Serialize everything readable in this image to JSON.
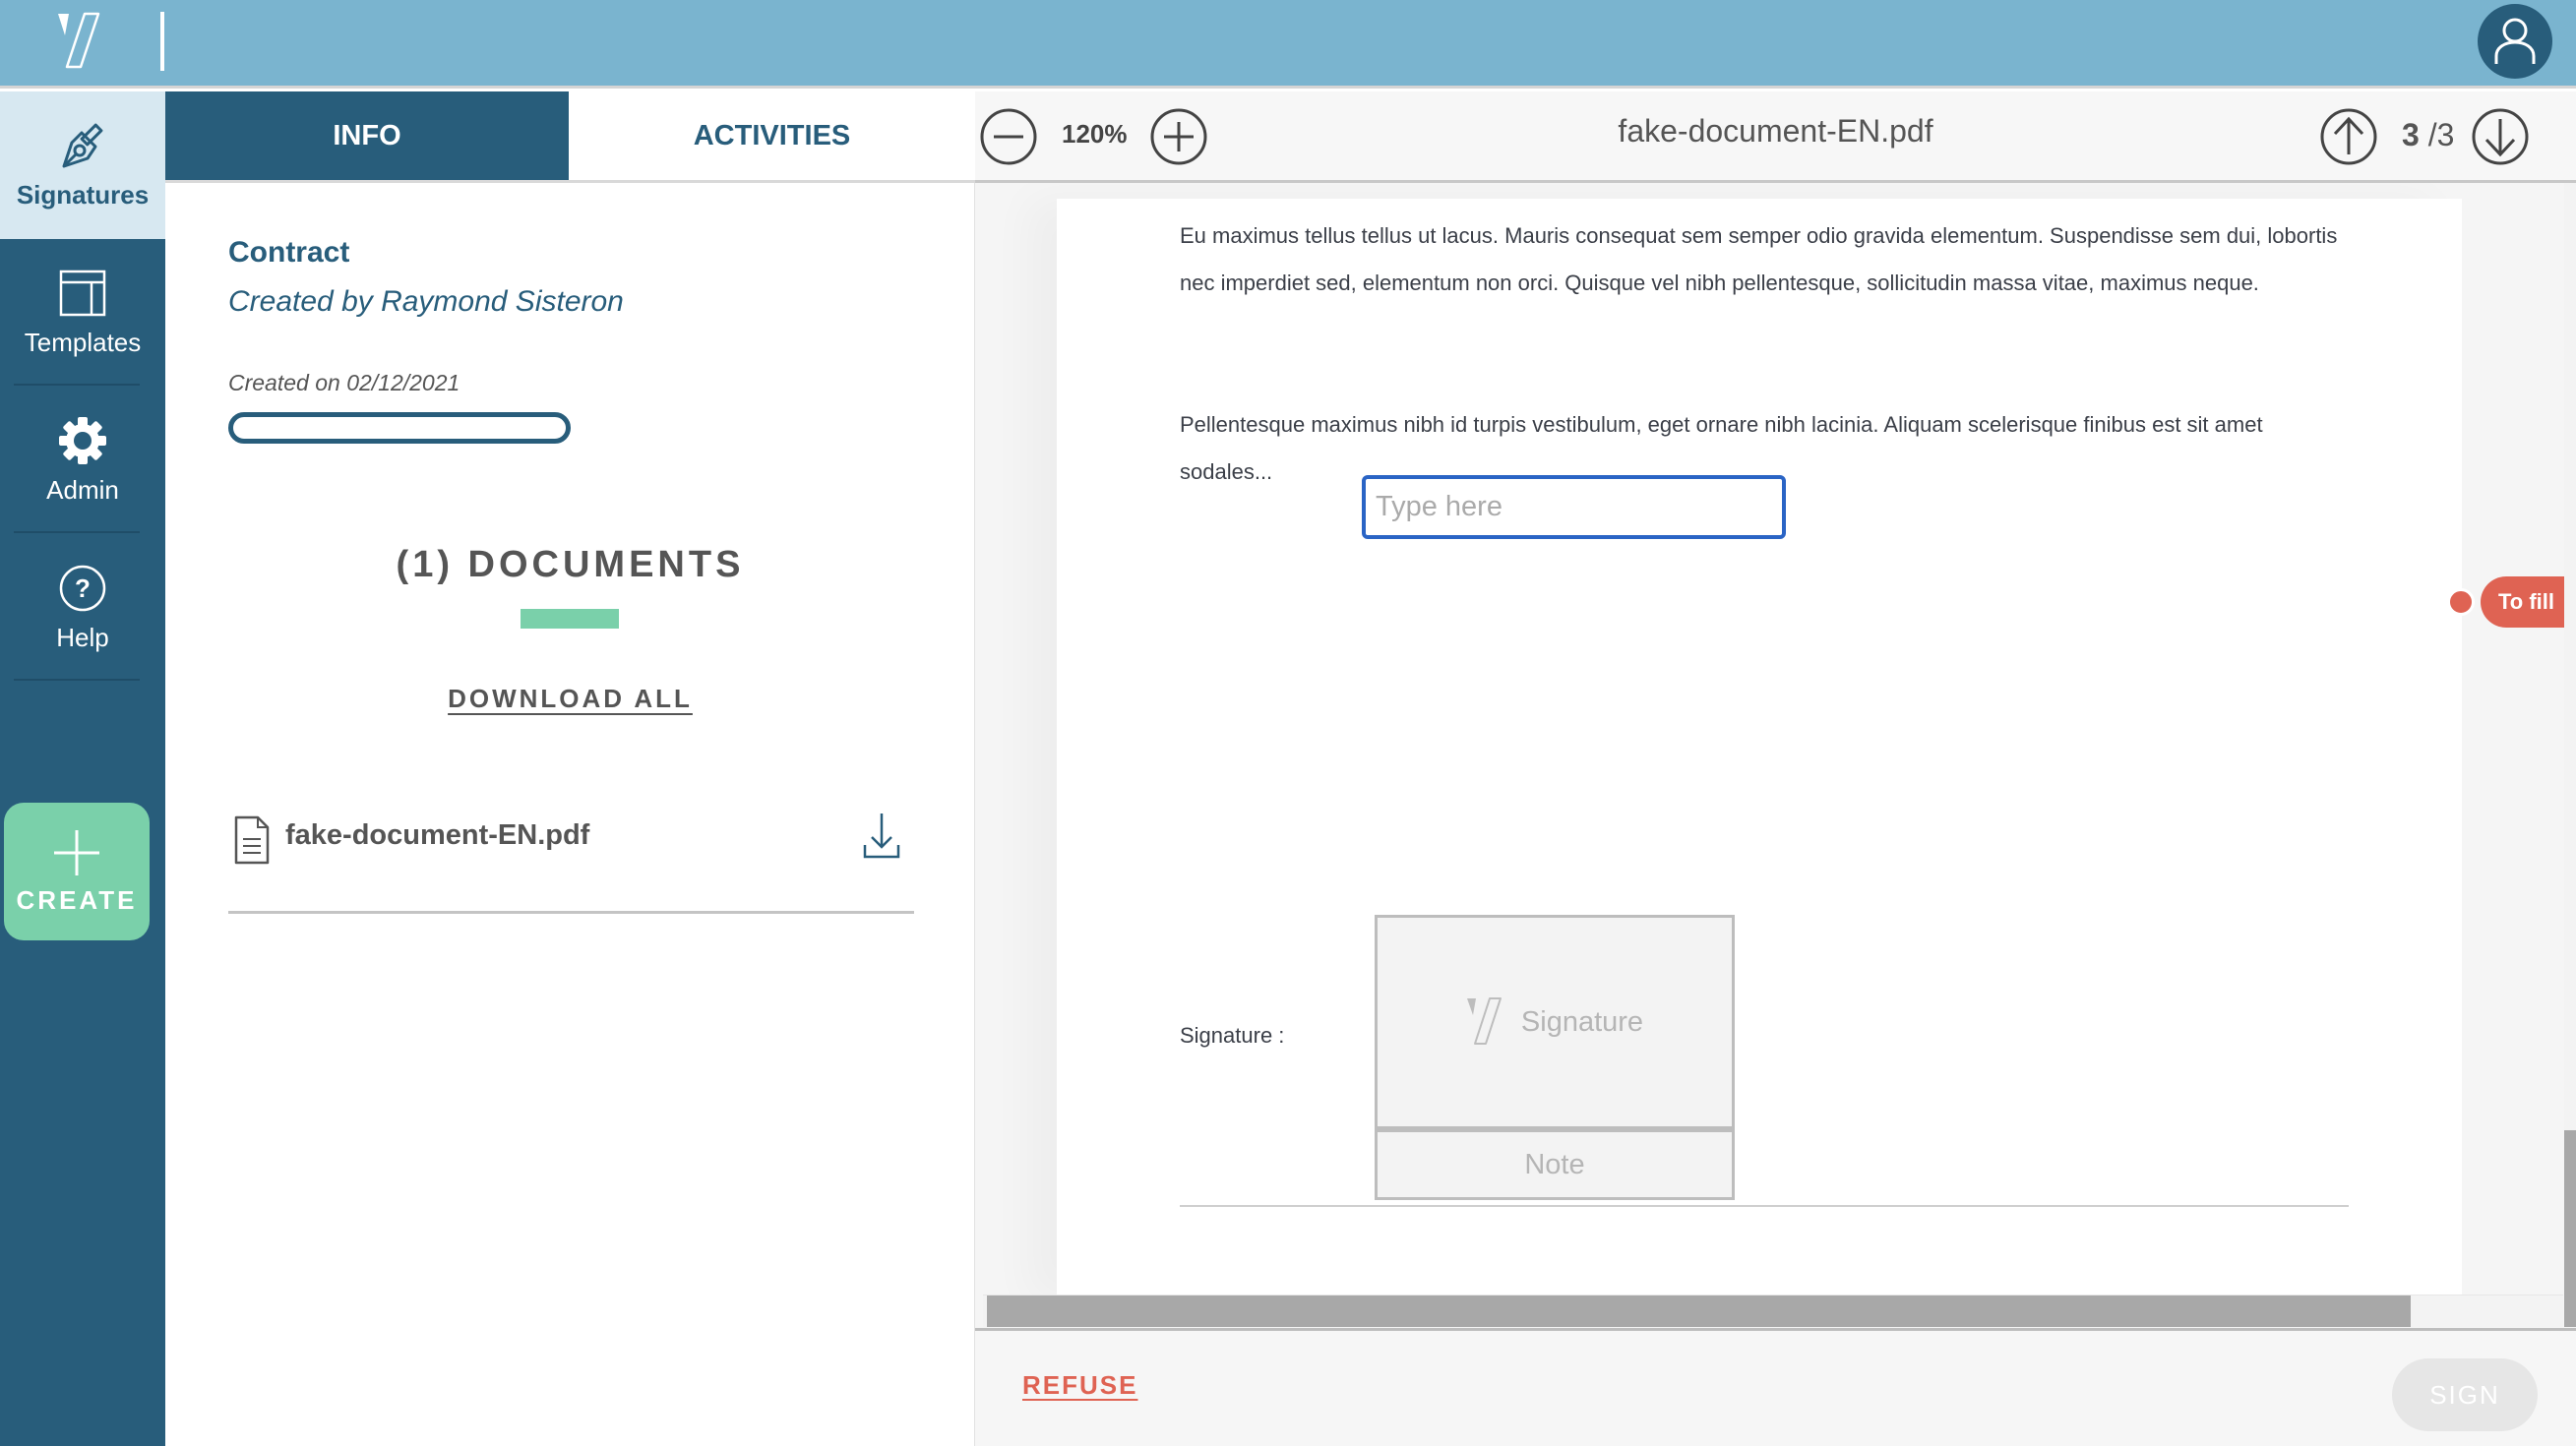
{
  "header": {
    "logo": "yousign-logo-icon",
    "user_menu": "user-avatar-icon"
  },
  "sidebar": {
    "items": [
      {
        "label": "Signatures",
        "icon": "fountain-pen-icon",
        "active": true
      },
      {
        "label": "Templates",
        "icon": "layout-template-icon",
        "active": false
      },
      {
        "label": "Admin",
        "icon": "gear-icon",
        "active": false
      },
      {
        "label": "Help",
        "icon": "question-circle-icon",
        "active": false
      }
    ],
    "create_label": "CREATE",
    "create_icon": "plus-icon"
  },
  "info_panel": {
    "tabs": [
      {
        "label": "INFO",
        "active": true
      },
      {
        "label": "ACTIVITIES",
        "active": false
      }
    ],
    "title": "Contract",
    "created_by": "Created by Raymond Sisteron",
    "created_on": "Created on 02/12/2021",
    "progress_percent": 0,
    "documents_heading": "(1) DOCUMENTS",
    "download_all_label": "DOWNLOAD ALL",
    "documents": [
      {
        "name": "fake-document-EN.pdf"
      }
    ]
  },
  "viewer": {
    "zoom_level": "120%",
    "file_title": "fake-document-EN.pdf",
    "current_page": "3",
    "page_separator": "/",
    "total_pages": "3",
    "paragraph_1": "Eu maximus tellus tellus ut lacus. Mauris consequat sem semper odio gravida elementum. Suspendisse sem dui, lobortis nec imperdiet sed, elementum non orci. Quisque vel nibh pellentesque, sollicitudin massa vitae, maximus neque.",
    "paragraph_2": "Pellentesque maximus nibh id turpis vestibulum, eget ornare nibh lacinia. Aliquam scelerisque finibus est sit amet sodales...",
    "text_field": {
      "value": "",
      "placeholder": "Type here"
    },
    "to_fill_label": "To fill",
    "signature_label": "Signature :",
    "signature_box_label": "Signature",
    "note_box_label": "Note"
  },
  "footer": {
    "refuse_label": "REFUSE",
    "sign_label": "SIGN"
  },
  "colors": {
    "header_bg": "#7ab4cf",
    "primary": "#285d7b",
    "accent_green": "#7ad0aa",
    "danger": "#df6353",
    "focus_blue": "#2a64c5"
  }
}
